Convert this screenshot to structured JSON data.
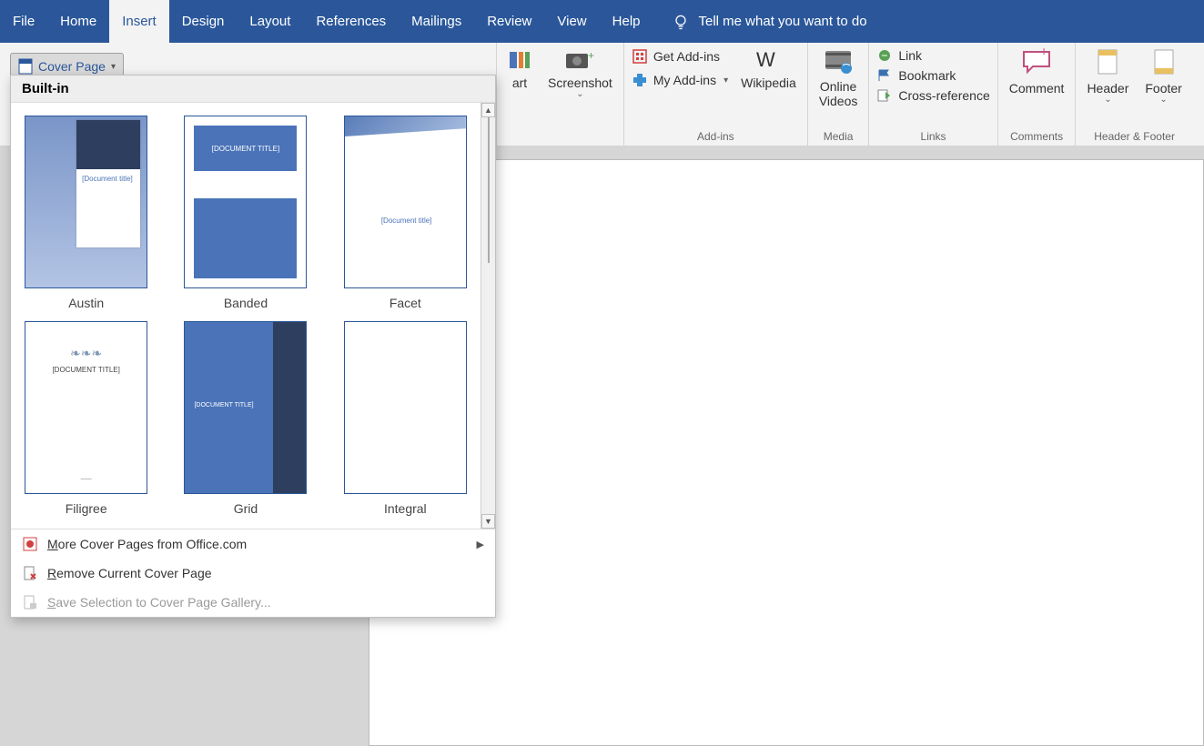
{
  "tabs": {
    "file": "File",
    "home": "Home",
    "insert": "Insert",
    "design": "Design",
    "layout": "Layout",
    "references": "References",
    "mailings": "Mailings",
    "review": "Review",
    "view": "View",
    "help": "Help"
  },
  "tellme": "Tell me what you want to do",
  "coverpage_btn": "Cover Page",
  "ribbon": {
    "art_suffix": "art",
    "screenshot": "Screenshot",
    "get_addins": "Get Add-ins",
    "my_addins": "My Add-ins",
    "wikipedia": "Wikipedia",
    "addins_group": "Add-ins",
    "online_videos": "Online Videos",
    "media_group": "Media",
    "link": "Link",
    "bookmark": "Bookmark",
    "crossref": "Cross-reference",
    "links_group": "Links",
    "comment": "Comment",
    "comments_group": "Comments",
    "header": "Header",
    "footer": "Footer",
    "headerfooter_group": "Header & Footer"
  },
  "dropdown": {
    "builtin": "Built-in",
    "templates": [
      {
        "name": "Austin",
        "doc_title": "[Document title]"
      },
      {
        "name": "Banded",
        "doc_title": "[DOCUMENT TITLE]"
      },
      {
        "name": "Facet",
        "doc_title": "[Document title]"
      },
      {
        "name": "Filigree",
        "doc_title": "[DOCUMENT TITLE]"
      },
      {
        "name": "Grid",
        "doc_title": "[DOCUMENT TITLE]"
      },
      {
        "name": "Integral",
        "doc_title": ""
      }
    ],
    "more": "ore Cover Pages from Office.com",
    "more_u": "M",
    "remove": "emove Current Cover Page",
    "remove_u": "R",
    "save": "ave Selection to Cover Page Gallery...",
    "save_u": "S"
  }
}
